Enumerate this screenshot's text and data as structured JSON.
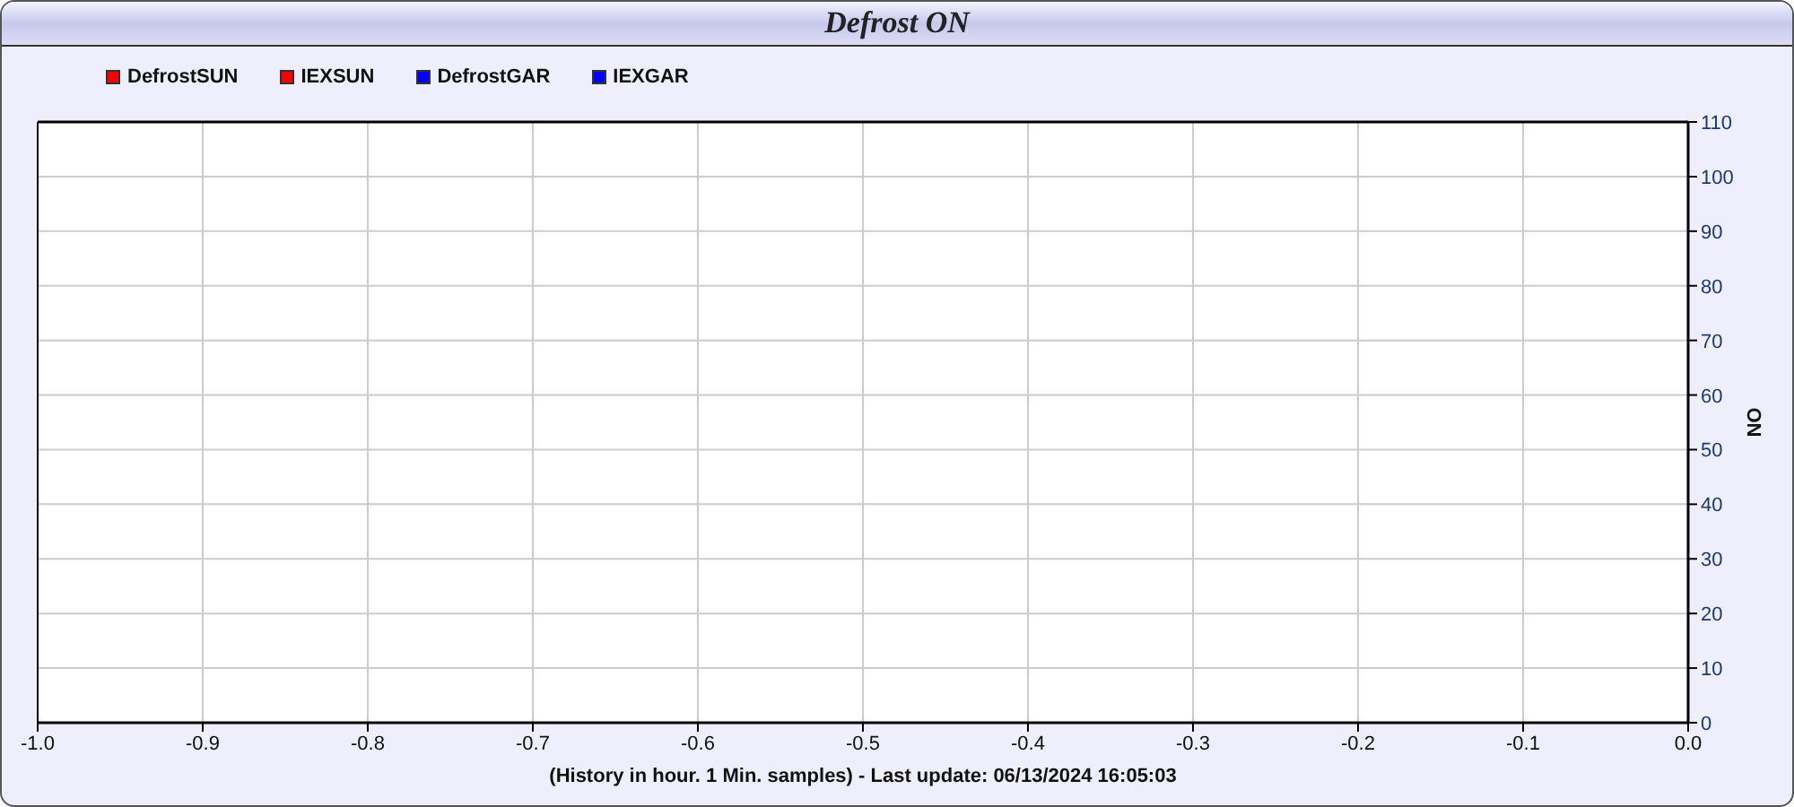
{
  "window": {
    "title": "Defrost ON"
  },
  "chart": {
    "chart_data": {
      "type": "line",
      "xlabel": "(History in hour. 1 Min. samples) - Last update: 06/13/2024 16:05:03",
      "ylabel": "ON",
      "grid": true,
      "categories": [
        "-1.0",
        "-0.9",
        "-0.8",
        "-0.7",
        "-0.6",
        "-0.5",
        "-0.4",
        "-0.3",
        "-0.2",
        "-0.1",
        "0.0"
      ],
      "ylim": [
        0,
        110
      ],
      "yticks": [
        0,
        10,
        20,
        30,
        40,
        50,
        60,
        70,
        80,
        90,
        100,
        110
      ],
      "series": [
        {
          "name": "DefrostSUN",
          "color": "#ff0000",
          "values": [
            null,
            null,
            null,
            null,
            null,
            null,
            null,
            null,
            null,
            null,
            null
          ]
        },
        {
          "name": "IEXSUN",
          "color": "#ff0000",
          "values": [
            null,
            null,
            null,
            null,
            null,
            null,
            null,
            null,
            null,
            null,
            null
          ]
        },
        {
          "name": "DefrostGAR",
          "color": "#0000ff",
          "values": [
            null,
            null,
            null,
            null,
            null,
            null,
            null,
            null,
            null,
            null,
            null
          ]
        },
        {
          "name": "IEXGAR",
          "color": "#0000ff",
          "values": [
            null,
            null,
            null,
            null,
            null,
            null,
            null,
            null,
            null,
            null,
            null
          ]
        }
      ]
    }
  }
}
